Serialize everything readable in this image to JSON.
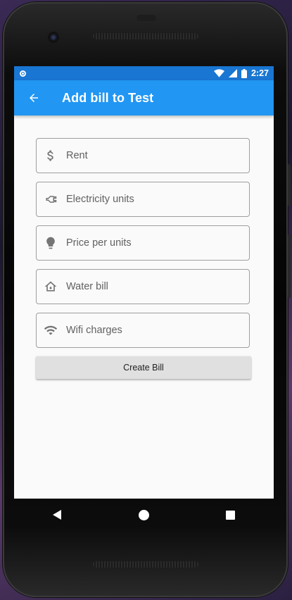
{
  "status_bar": {
    "time": "2:27"
  },
  "app_bar": {
    "title": "Add bill to Test",
    "back_icon": "arrow-back-icon",
    "background": "#2196f3",
    "status_background": "#1976d2"
  },
  "form": {
    "fields": [
      {
        "icon": "dollar-icon",
        "placeholder": "Rent"
      },
      {
        "icon": "power-plug-icon",
        "placeholder": "Electricity units"
      },
      {
        "icon": "lightbulb-icon",
        "placeholder": "Price per units"
      },
      {
        "icon": "house-icon",
        "placeholder": "Water bill"
      },
      {
        "icon": "wifi-icon",
        "placeholder": "Wifi charges"
      }
    ],
    "submit_label": "Create Bill"
  },
  "nav_bar": {
    "items": [
      "back-triangle-icon",
      "home-circle-icon",
      "recents-square-icon"
    ]
  }
}
